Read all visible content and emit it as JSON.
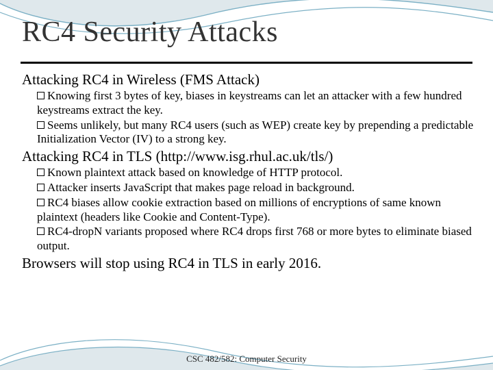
{
  "title": "RC4 Security Attacks",
  "sections": [
    {
      "heading": "Attacking RC4 in Wireless (FMS Attack)",
      "bullets": [
        "Knowing first 3 bytes of key, biases in keystreams can let an attacker with a few hundred keystreams extract the key.",
        "Seems unlikely, but many RC4 users (such as WEP) create key by prepending a predictable Initialization Vector (IV) to a strong key."
      ]
    },
    {
      "heading": "Attacking RC4 in TLS (http://www.isg.rhul.ac.uk/tls/)",
      "bullets": [
        "Known plaintext attack based on knowledge of HTTP protocol.",
        "Attacker inserts JavaScript that makes page reload in background.",
        "RC4 biases allow cookie extraction based on millions of encryptions of same known plaintext (headers like Cookie and Content-Type).",
        "RC4-dropN variants proposed where RC4 drops first 768 or more bytes to eliminate biased output."
      ]
    },
    {
      "heading": "Browsers will stop using RC4 in TLS in early 2016.",
      "bullets": []
    }
  ],
  "footer": "CSC 482/582: Computer Security"
}
